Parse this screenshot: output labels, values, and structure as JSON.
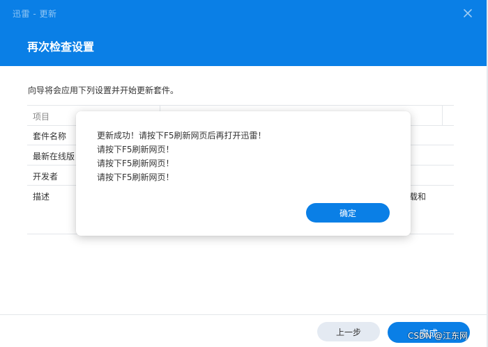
{
  "window": {
    "title": "迅雷 - 更新",
    "heading": "再次检查设置",
    "close_icon": "close-icon"
  },
  "intro_text": "向导将会应用下列设置并开始更新套件。",
  "table": {
    "header": "项目",
    "rows": [
      {
        "label": "套件名称"
      },
      {
        "label": "最新在线版"
      },
      {
        "label": "开发者"
      },
      {
        "label": "描述",
        "value_tail": "载和"
      }
    ]
  },
  "footer": {
    "prev_label": "上一步",
    "finish_label": "完成"
  },
  "modal": {
    "lines": [
      "更新成功！请按下F5刷新网页后再打开迅雷！",
      "请按下F5刷新网页！",
      "请按下F5刷新网页！",
      "请按下F5刷新网页！"
    ],
    "ok_label": "确定"
  },
  "watermark": "CSDN @江东网",
  "colors": {
    "accent": "#0a7fe6",
    "secondary_button": "#e4eaf2",
    "border": "#e3e6ea"
  }
}
